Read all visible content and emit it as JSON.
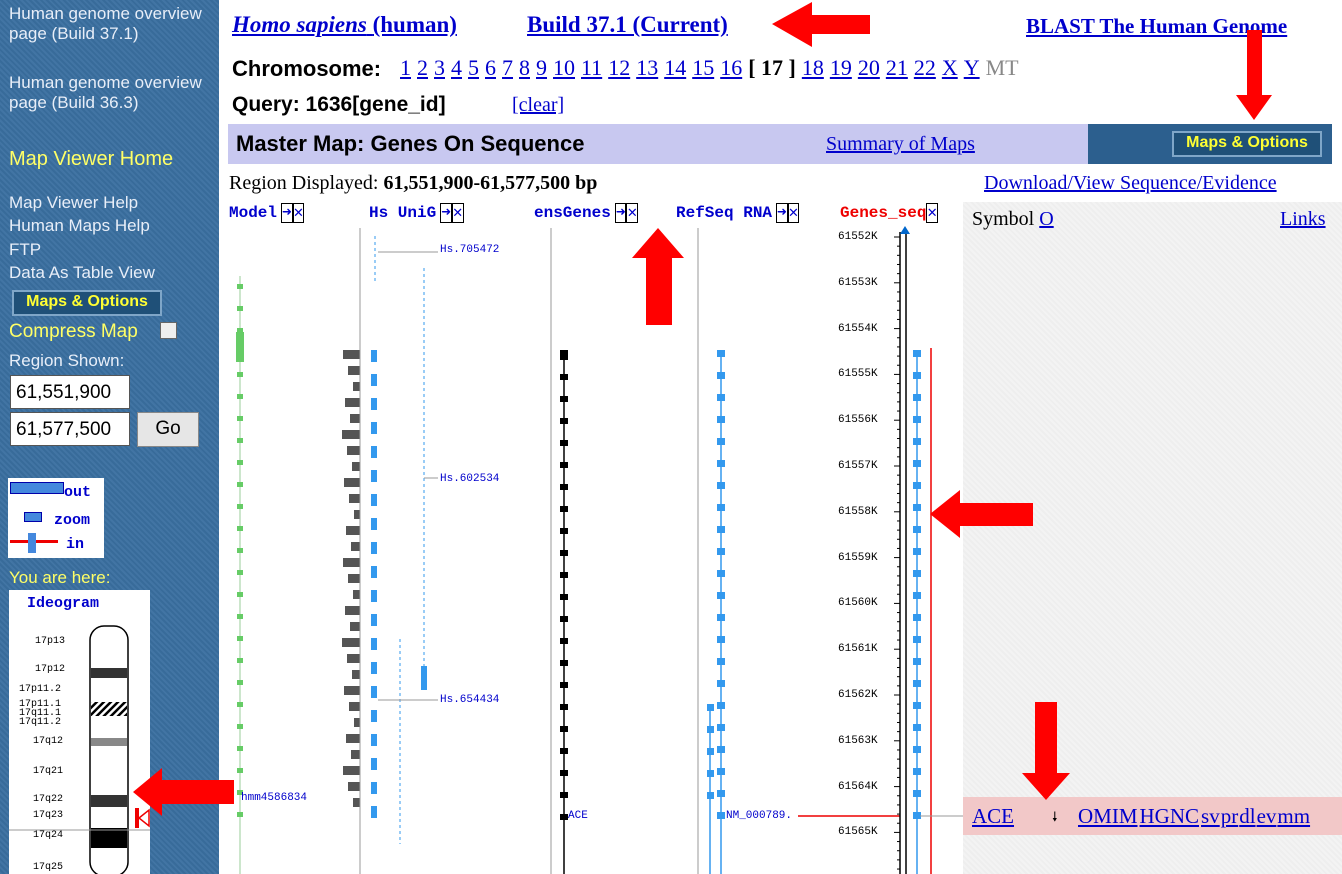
{
  "sidebar": {
    "links": [
      "Human genome overview page (Build 37.1)",
      "Human genome overview page (Build 36.3)"
    ],
    "map_viewer_home": "Map Viewer Home",
    "help_links": [
      "Map Viewer Help",
      "Human Maps Help",
      "FTP",
      "Data As Table View"
    ],
    "maps_options": "Maps & Options",
    "compress_map": "Compress Map",
    "region_shown": "Region Shown:",
    "region_from": "61,551,900",
    "region_to": "61,577,500",
    "go": "Go",
    "zoom_labels": [
      "out",
      "zoom",
      "in"
    ],
    "you_are_here": "You are here:",
    "ideogram_title": "Ideogram",
    "bands": [
      "17p13",
      "17p12",
      "17p11.2",
      "17p11.1",
      "17q11.1",
      "17q11.2",
      "17q12",
      "17q21",
      "17q22",
      "17q23",
      "17q24",
      "17q25"
    ]
  },
  "header": {
    "organism_italic": "Homo sapiens",
    "organism_common": "(human)",
    "build": "Build 37.1 (Current)",
    "blast": "BLAST The Human Genome",
    "chromosome_label": "Chromosome:",
    "chromosomes": [
      "1",
      "2",
      "3",
      "4",
      "5",
      "6",
      "7",
      "8",
      "9",
      "10",
      "11",
      "12",
      "13",
      "14",
      "15",
      "16",
      "17",
      "18",
      "19",
      "20",
      "21",
      "22",
      "X",
      "Y",
      "MT"
    ],
    "current_chromosome": "17",
    "query_label": "Query: 1636[gene_id]",
    "clear": "[clear]"
  },
  "master": {
    "title": "Master Map: Genes On Sequence",
    "summary": "Summary of Maps",
    "maps_options": "Maps & Options",
    "region_label": "Region Displayed:",
    "region_value": "61,551,900-61,577,500 bp",
    "download": "Download/View Sequence/Evidence"
  },
  "tracks": [
    "Model",
    "Hs UniG",
    "ensGenes",
    "RefSeq RNA",
    "Genes_seq"
  ],
  "track_labels": {
    "unigene": [
      "Hs.705472",
      "Hs.602534",
      "Hs.654434"
    ],
    "model": "hmm4586834",
    "ensgenes": "ACE",
    "refseq": "NM_000789."
  },
  "ruler": [
    "61552K",
    "61553K",
    "61554K",
    "61555K",
    "61556K",
    "61557K",
    "61558K",
    "61559K",
    "61560K",
    "61561K",
    "61562K",
    "61563K",
    "61564K",
    "61565K"
  ],
  "results": {
    "symbol_header": "Symbol",
    "symbol_link": "O",
    "links_header": "Links",
    "gene": "ACE",
    "links": [
      "OMIM",
      "HGNC",
      "sv",
      "pr",
      "dl",
      "ev",
      "mm"
    ]
  },
  "colors": {
    "sidebar": "#3a6fa0",
    "header_band": "#c8c8f0",
    "arrow": "#ff0000",
    "link": "#0000cc",
    "refseq": "#3399ee"
  }
}
